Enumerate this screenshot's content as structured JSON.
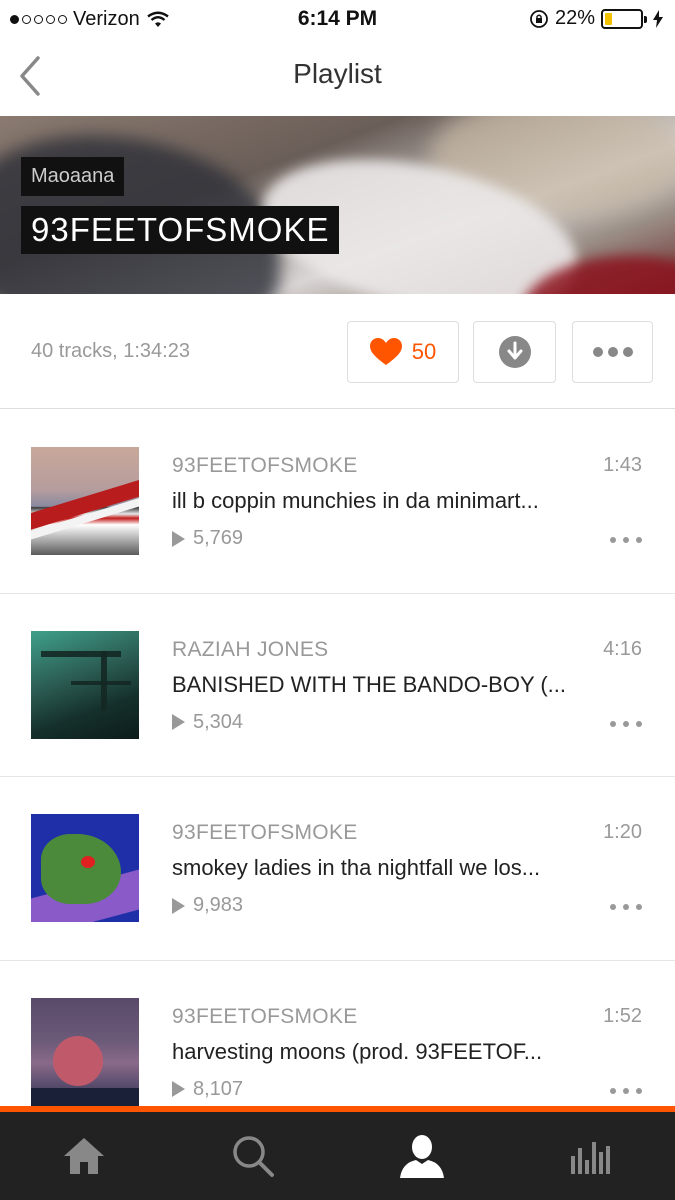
{
  "status_bar": {
    "carrier": "Verizon",
    "time": "6:14 PM",
    "battery": "22%",
    "battery_level": 0.22,
    "signal_bars": 1
  },
  "nav": {
    "title": "Playlist"
  },
  "header": {
    "artist": "Maoaana",
    "playlist_name": "93FEETOFSMOKE"
  },
  "summary": {
    "tracks_text": "40 tracks, 1:34:23",
    "like_count": "50"
  },
  "colors": {
    "accent": "#ff5500",
    "tab_bar": "#222222"
  },
  "tracks": [
    {
      "user": "93FEETOFSMOKE",
      "title": "ill b coppin munchies in da minimart...",
      "duration": "1:43",
      "plays": "5,769"
    },
    {
      "user": "RAZIAH JONES",
      "title": "BANISHED WITH THE BANDO-BOY (...",
      "duration": "4:16",
      "plays": "5,304"
    },
    {
      "user": "93FEETOFSMOKE",
      "title": "smokey ladies in tha nightfall we los...",
      "duration": "1:20",
      "plays": "9,983"
    },
    {
      "user": "93FEETOFSMOKE",
      "title": "harvesting moons (prod. 93FEETOF...",
      "duration": "1:52",
      "plays": "8,107"
    }
  ],
  "tabs": [
    {
      "icon": "home-icon"
    },
    {
      "icon": "search-icon"
    },
    {
      "icon": "profile-icon",
      "active": true
    },
    {
      "icon": "stream-icon"
    }
  ]
}
